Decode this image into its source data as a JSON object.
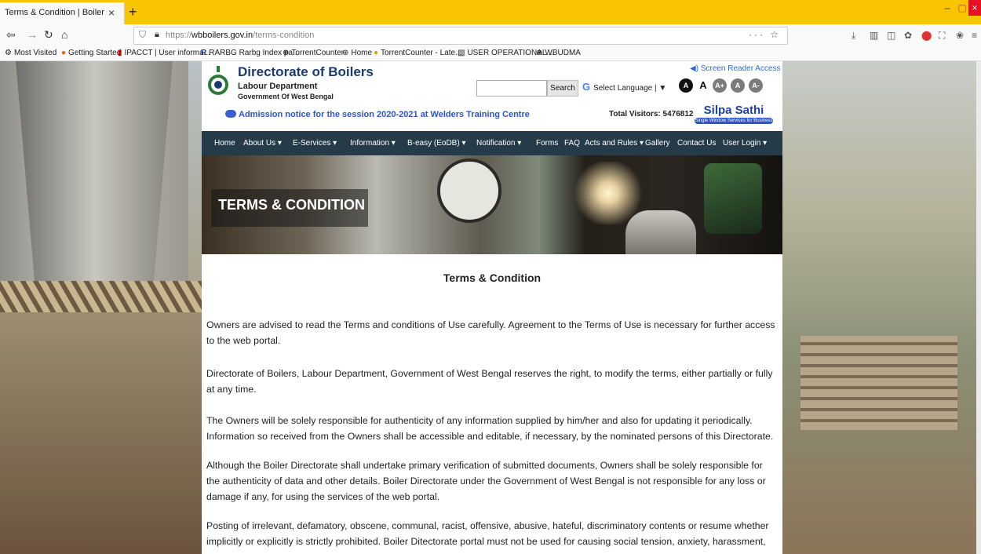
{
  "browser": {
    "tab_title": "Terms & Condition | Boiler",
    "tab_close": "×",
    "new_tab": "+",
    "url_prefix": "https://",
    "url_domain": "wbboilers.gov.in",
    "url_path": "/terms-condition",
    "url_right": "···  ☆",
    "window_min": "–",
    "window_max": "▢",
    "window_close": "×",
    "bookmarks": [
      "Most Visited",
      "Getting Started",
      "IPACCT | User informa...",
      "RARBG Rarbg Index pa...",
      "TorrentCounter",
      "Home",
      "TorrentCounter - Late...",
      "USER OPERATIONAL ...",
      "WBUDMA"
    ]
  },
  "header": {
    "title": "Directorate of Boilers",
    "department": "Labour Department",
    "government": "Government Of West Bengal",
    "search_placeholder": "",
    "search_button": "Search",
    "language": "Select Language",
    "language_arrow": "▼",
    "contrast_dark": "A",
    "font_normal": "A",
    "font_plus": "A+",
    "font_reset": "A",
    "font_minus": "A-",
    "screen_reader": "Screen Reader Access",
    "notice": "Admission notice for the session 2020-2021 at Welders Training Centre",
    "visitors": "Total Visitors: 5476812",
    "silpa_title": "Silpa Sathi",
    "silpa_sub": "Single Window Services for Business"
  },
  "menu": [
    "Home",
    "About Us ▾",
    "E-Services ▾",
    "Information ▾",
    "B-easy (EoDB) ▾",
    "Notification ▾",
    "Forms",
    "FAQ",
    "Acts and Rules ▾",
    "Gallery",
    "Contact Us",
    "User Login ▾"
  ],
  "banner": {
    "title": "TERMS & CONDITION"
  },
  "content": {
    "heading": "Terms & Condition",
    "paragraphs": [
      "Owners are advised to read the Terms and conditions of Use carefully. Agreement to the Terms of Use is necessary for further access to the web portal.",
      "Directorate of Boilers, Labour Department, Government of West Bengal reserves the right, to modify the terms, either partially or fully at any time.",
      "The Owners will be solely responsible for authenticity of any information supplied by him/her and also for updating it periodically. Information so received from the Owners shall be accessible and editable, if necessary, by the nominated persons of this Directorate.",
      "Although the Boiler Directorate shall undertake primary verification of submitted documents, Owners shall be solely responsible for the authenticity of data and other details. Boiler Directorate under the Government of West Bengal is not responsible for any loss or damage if any, for using the services of the web portal.",
      "Posting of irrelevant, defamatory, obscene, communal, racist, offensive, abusive, hateful, discriminatory contents or resume whether implicitly or explicitly is strictly prohibited. Boiler Ditectorate portal must not be used for causing social tension, anxiety, harassment,"
    ]
  },
  "colors": {
    "tabbar": "#f9c400",
    "menu_bg": "#253b47",
    "title_blue": "#1b3a72",
    "link_blue": "#2b55c8"
  }
}
